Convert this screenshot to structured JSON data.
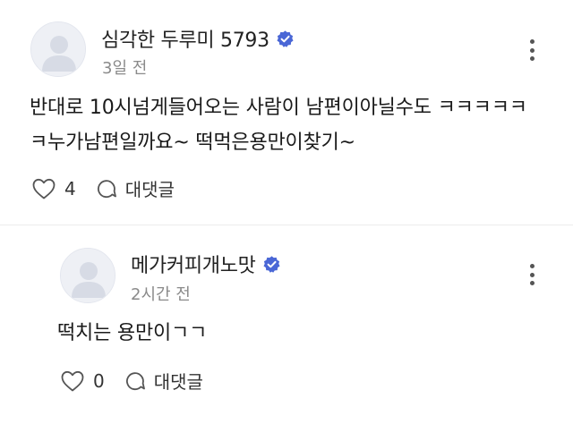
{
  "comments": [
    {
      "author": "심각한 두루미 5793",
      "time": "3일 전",
      "text": "반대로 10시넘게들어오는 사람이 남편이아닐수도 ㅋㅋㅋㅋㅋㅋ누가남편일까요~ 떡먹은용만이찾기~",
      "likes": "4",
      "reply_label": "대댓글",
      "verified": true
    },
    {
      "author": "메가커피개노맛",
      "time": "2시간 전",
      "text": "떡치는 용만이ㄱㄱ",
      "likes": "0",
      "reply_label": "대댓글",
      "verified": true
    }
  ],
  "colors": {
    "verified_badge": "#4a67d6",
    "avatar_bg": "#eef0f5",
    "avatar_figure": "#d7dbe5",
    "muted_text": "#8a8a8a"
  },
  "icons": {
    "avatar": "person-silhouette-icon",
    "verified": "verified-badge-icon",
    "more": "more-vertical-icon",
    "like": "heart-outline-icon",
    "reply": "speech-bubble-icon"
  }
}
